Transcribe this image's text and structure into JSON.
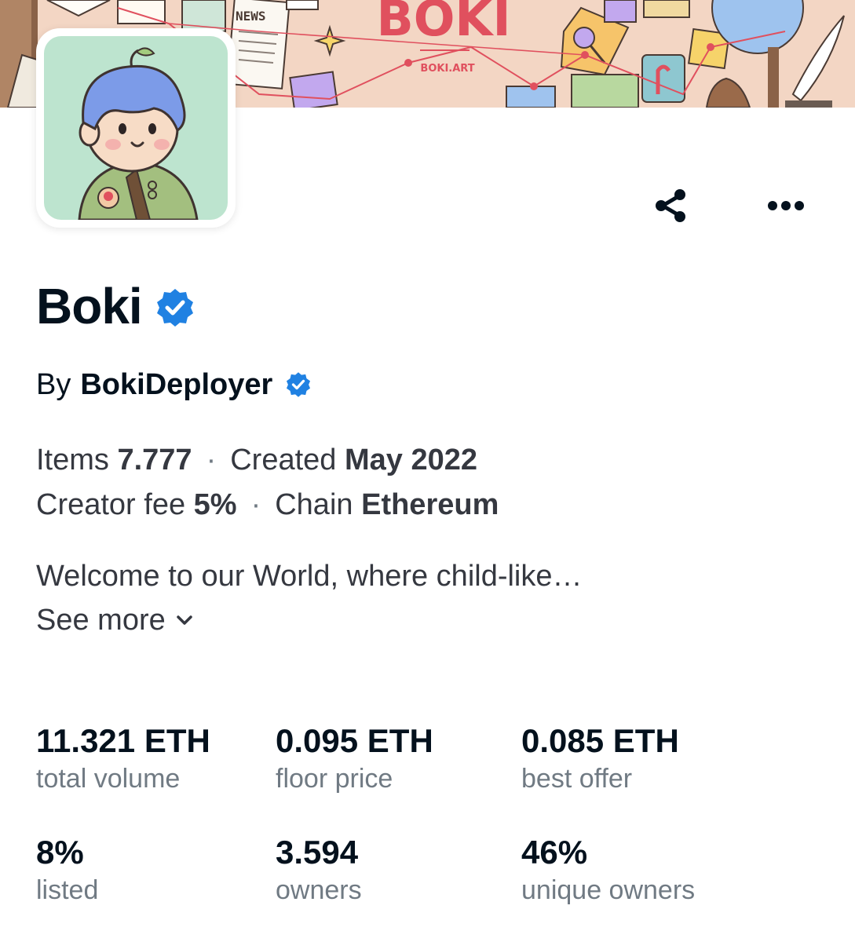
{
  "banner": {
    "news_text": "NEWS",
    "logo_text": "BOKI",
    "logo_sub": "BOKI.ART"
  },
  "actions": {
    "share_icon": "share-icon",
    "more_icon": "more-horizontal-icon"
  },
  "collection": {
    "name": "Boki",
    "verified_icon": "verified-badge-icon",
    "by_label": "By",
    "creator": "BokiDeployer",
    "meta": {
      "items_label": "Items",
      "items_value": "7.777",
      "created_label": "Created",
      "created_value": "May 2022",
      "fee_label": "Creator fee",
      "fee_value": "5%",
      "chain_label": "Chain",
      "chain_value": "Ethereum",
      "separator": "·"
    },
    "description": "Welcome to our World, where child-like…",
    "see_more": "See more"
  },
  "stats": [
    {
      "value": "11.321 ETH",
      "label": "total volume"
    },
    {
      "value": "0.095 ETH",
      "label": "floor price"
    },
    {
      "value": "0.085 ETH",
      "label": "best offer"
    },
    {
      "value": "8%",
      "label": "listed"
    },
    {
      "value": "3.594",
      "label": "owners"
    },
    {
      "value": "46%",
      "label": "unique owners"
    }
  ],
  "colors": {
    "text_primary": "#04111d",
    "text_secondary": "#707a83",
    "verified_blue": "#2081e2",
    "banner_red": "#e0505e"
  }
}
